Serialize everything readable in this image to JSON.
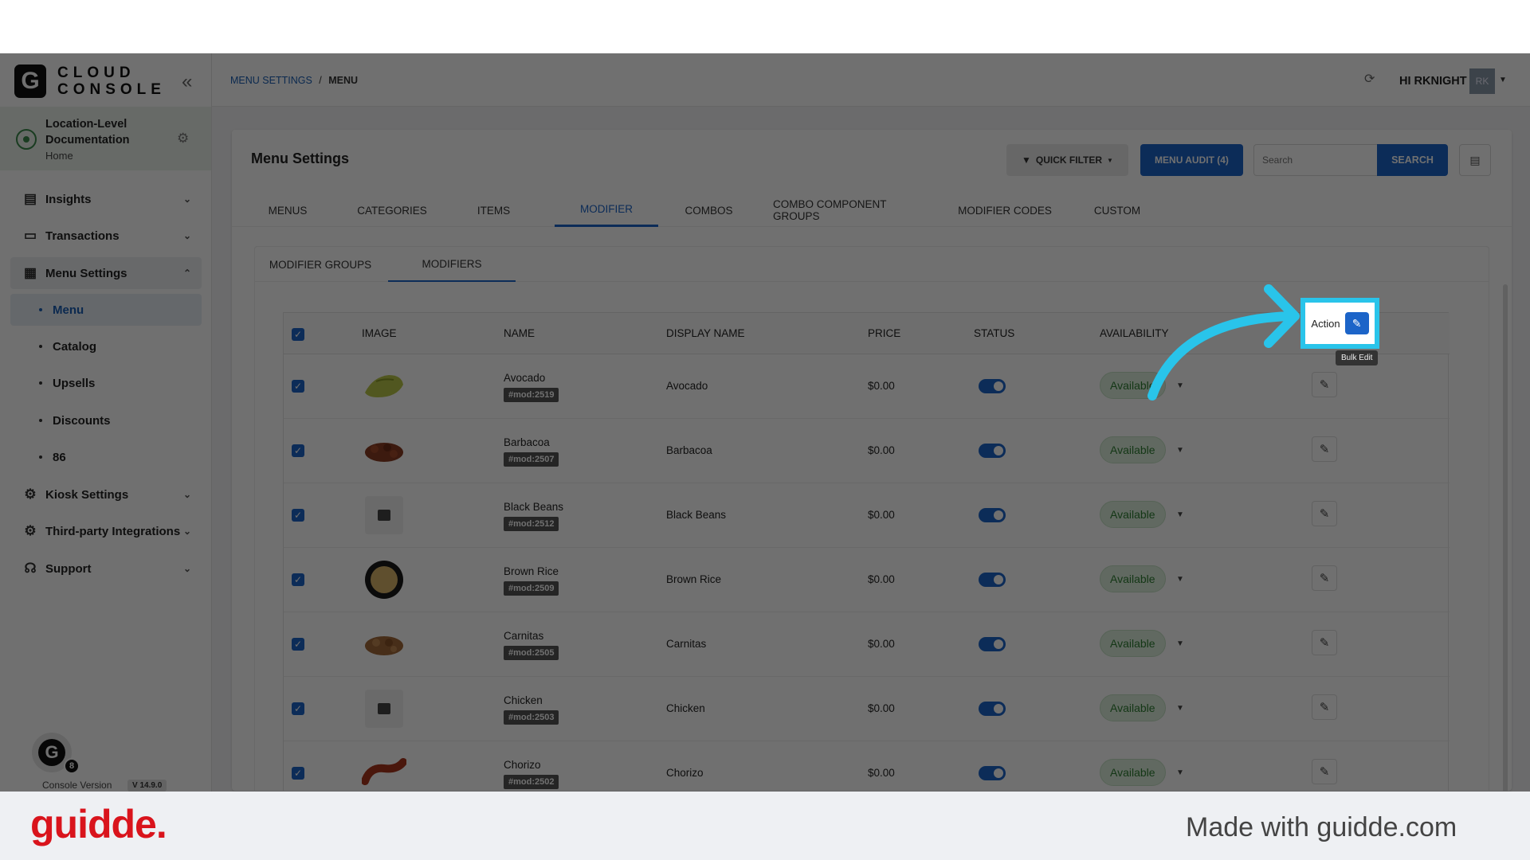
{
  "sidebar": {
    "logo_letter": "G",
    "logo_line1": "CLOUD",
    "logo_line2": "CONSOLE",
    "location_name": "Location-Level Documentation",
    "location_sub": "Home",
    "nav": [
      {
        "label": "Insights",
        "icon": "insights-icon"
      },
      {
        "label": "Transactions",
        "icon": "transactions-icon"
      },
      {
        "label": "Menu Settings",
        "icon": "menu-settings-icon"
      },
      {
        "label": "Kiosk Settings",
        "icon": "kiosk-icon"
      },
      {
        "label": "Third-party Integrations",
        "icon": "integrations-icon"
      },
      {
        "label": "Support",
        "icon": "support-icon"
      }
    ],
    "sub": [
      "Menu",
      "Catalog",
      "Upsells",
      "Discounts",
      "86"
    ],
    "avatar_letter": "G",
    "avatar_badge": "8",
    "version_label": "Console Version",
    "version_value": "V 14.9.0"
  },
  "header": {
    "crumb_link": "MENU SETTINGS",
    "crumb_sep": "/",
    "crumb_current": "MENU",
    "user": "HI RKNIGHT",
    "user_initials": "RK"
  },
  "card": {
    "title": "Menu Settings",
    "quick_filter": "QUICK FILTER",
    "audit": "MENU AUDIT (4)",
    "search_placeholder": "Search",
    "search_button": "SEARCH",
    "tabs": [
      "MENUS",
      "CATEGORIES",
      "ITEMS",
      "MODIFIER",
      "COMBOS",
      "COMBO COMPONENT GROUPS",
      "MODIFIER CODES",
      "CUSTOM"
    ],
    "active_tab": "MODIFIER",
    "subtabs": [
      "MODIFIER GROUPS",
      "MODIFIERS"
    ],
    "active_subtab": "MODIFIERS"
  },
  "table": {
    "columns": [
      "IMAGE",
      "NAME",
      "DISPLAY NAME",
      "PRICE",
      "STATUS",
      "AVAILABILITY"
    ],
    "rows": [
      {
        "name": "Avocado",
        "tag": "#mod:2519",
        "display": "Avocado",
        "price": "$0.00",
        "availability": "Available",
        "image": "avocado"
      },
      {
        "name": "Barbacoa",
        "tag": "#mod:2507",
        "display": "Barbacoa",
        "price": "$0.00",
        "availability": "Available",
        "image": "meat"
      },
      {
        "name": "Black Beans",
        "tag": "#mod:2512",
        "display": "Black Beans",
        "price": "$0.00",
        "availability": "Available",
        "image": "placeholder"
      },
      {
        "name": "Brown Rice",
        "tag": "#mod:2509",
        "display": "Brown Rice",
        "price": "$0.00",
        "availability": "Available",
        "image": "rice"
      },
      {
        "name": "Carnitas",
        "tag": "#mod:2505",
        "display": "Carnitas",
        "price": "$0.00",
        "availability": "Available",
        "image": "meat"
      },
      {
        "name": "Chicken",
        "tag": "#mod:2503",
        "display": "Chicken",
        "price": "$0.00",
        "availability": "Available",
        "image": "placeholder"
      },
      {
        "name": "Chorizo",
        "tag": "#mod:2502",
        "display": "Chorizo",
        "price": "$0.00",
        "availability": "Available",
        "image": "chorizo"
      }
    ]
  },
  "highlight": {
    "action_label": "Action",
    "tooltip": "Bulk Edit",
    "highlight_color": "#29c4ea"
  },
  "footer": {
    "brand": "guidde.",
    "made_with": "Made with guidde.com"
  }
}
